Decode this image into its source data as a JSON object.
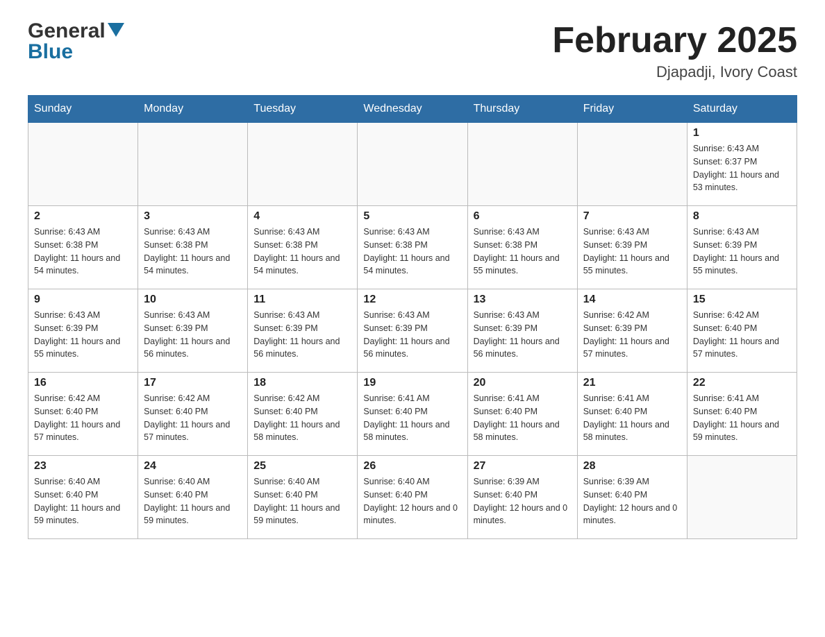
{
  "logo": {
    "general": "General",
    "blue": "Blue"
  },
  "title": {
    "month": "February 2025",
    "location": "Djapadji, Ivory Coast"
  },
  "days_of_week": [
    "Sunday",
    "Monday",
    "Tuesday",
    "Wednesday",
    "Thursday",
    "Friday",
    "Saturday"
  ],
  "weeks": [
    [
      {
        "day": "",
        "info": ""
      },
      {
        "day": "",
        "info": ""
      },
      {
        "day": "",
        "info": ""
      },
      {
        "day": "",
        "info": ""
      },
      {
        "day": "",
        "info": ""
      },
      {
        "day": "",
        "info": ""
      },
      {
        "day": "1",
        "info": "Sunrise: 6:43 AM\nSunset: 6:37 PM\nDaylight: 11 hours and 53 minutes."
      }
    ],
    [
      {
        "day": "2",
        "info": "Sunrise: 6:43 AM\nSunset: 6:38 PM\nDaylight: 11 hours and 54 minutes."
      },
      {
        "day": "3",
        "info": "Sunrise: 6:43 AM\nSunset: 6:38 PM\nDaylight: 11 hours and 54 minutes."
      },
      {
        "day": "4",
        "info": "Sunrise: 6:43 AM\nSunset: 6:38 PM\nDaylight: 11 hours and 54 minutes."
      },
      {
        "day": "5",
        "info": "Sunrise: 6:43 AM\nSunset: 6:38 PM\nDaylight: 11 hours and 54 minutes."
      },
      {
        "day": "6",
        "info": "Sunrise: 6:43 AM\nSunset: 6:38 PM\nDaylight: 11 hours and 55 minutes."
      },
      {
        "day": "7",
        "info": "Sunrise: 6:43 AM\nSunset: 6:39 PM\nDaylight: 11 hours and 55 minutes."
      },
      {
        "day": "8",
        "info": "Sunrise: 6:43 AM\nSunset: 6:39 PM\nDaylight: 11 hours and 55 minutes."
      }
    ],
    [
      {
        "day": "9",
        "info": "Sunrise: 6:43 AM\nSunset: 6:39 PM\nDaylight: 11 hours and 55 minutes."
      },
      {
        "day": "10",
        "info": "Sunrise: 6:43 AM\nSunset: 6:39 PM\nDaylight: 11 hours and 56 minutes."
      },
      {
        "day": "11",
        "info": "Sunrise: 6:43 AM\nSunset: 6:39 PM\nDaylight: 11 hours and 56 minutes."
      },
      {
        "day": "12",
        "info": "Sunrise: 6:43 AM\nSunset: 6:39 PM\nDaylight: 11 hours and 56 minutes."
      },
      {
        "day": "13",
        "info": "Sunrise: 6:43 AM\nSunset: 6:39 PM\nDaylight: 11 hours and 56 minutes."
      },
      {
        "day": "14",
        "info": "Sunrise: 6:42 AM\nSunset: 6:39 PM\nDaylight: 11 hours and 57 minutes."
      },
      {
        "day": "15",
        "info": "Sunrise: 6:42 AM\nSunset: 6:40 PM\nDaylight: 11 hours and 57 minutes."
      }
    ],
    [
      {
        "day": "16",
        "info": "Sunrise: 6:42 AM\nSunset: 6:40 PM\nDaylight: 11 hours and 57 minutes."
      },
      {
        "day": "17",
        "info": "Sunrise: 6:42 AM\nSunset: 6:40 PM\nDaylight: 11 hours and 57 minutes."
      },
      {
        "day": "18",
        "info": "Sunrise: 6:42 AM\nSunset: 6:40 PM\nDaylight: 11 hours and 58 minutes."
      },
      {
        "day": "19",
        "info": "Sunrise: 6:41 AM\nSunset: 6:40 PM\nDaylight: 11 hours and 58 minutes."
      },
      {
        "day": "20",
        "info": "Sunrise: 6:41 AM\nSunset: 6:40 PM\nDaylight: 11 hours and 58 minutes."
      },
      {
        "day": "21",
        "info": "Sunrise: 6:41 AM\nSunset: 6:40 PM\nDaylight: 11 hours and 58 minutes."
      },
      {
        "day": "22",
        "info": "Sunrise: 6:41 AM\nSunset: 6:40 PM\nDaylight: 11 hours and 59 minutes."
      }
    ],
    [
      {
        "day": "23",
        "info": "Sunrise: 6:40 AM\nSunset: 6:40 PM\nDaylight: 11 hours and 59 minutes."
      },
      {
        "day": "24",
        "info": "Sunrise: 6:40 AM\nSunset: 6:40 PM\nDaylight: 11 hours and 59 minutes."
      },
      {
        "day": "25",
        "info": "Sunrise: 6:40 AM\nSunset: 6:40 PM\nDaylight: 11 hours and 59 minutes."
      },
      {
        "day": "26",
        "info": "Sunrise: 6:40 AM\nSunset: 6:40 PM\nDaylight: 12 hours and 0 minutes."
      },
      {
        "day": "27",
        "info": "Sunrise: 6:39 AM\nSunset: 6:40 PM\nDaylight: 12 hours and 0 minutes."
      },
      {
        "day": "28",
        "info": "Sunrise: 6:39 AM\nSunset: 6:40 PM\nDaylight: 12 hours and 0 minutes."
      },
      {
        "day": "",
        "info": ""
      }
    ]
  ]
}
